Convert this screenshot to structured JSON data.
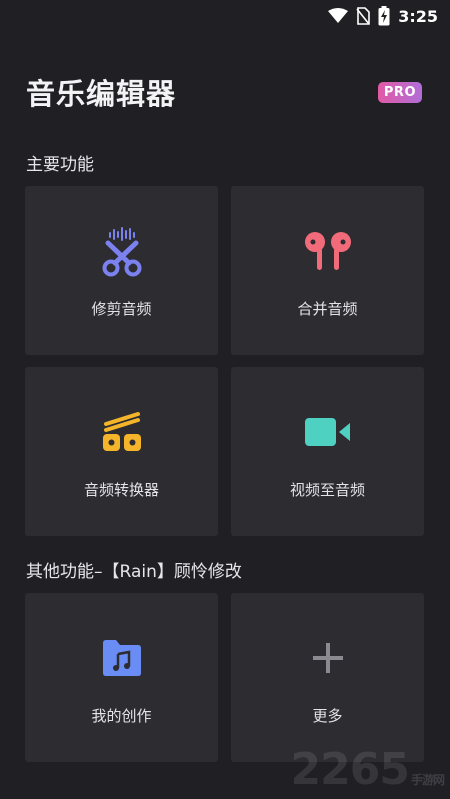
{
  "status_bar": {
    "time": "3:25",
    "icons": [
      "wifi-icon",
      "no-sim-icon",
      "battery-charging-icon"
    ]
  },
  "header": {
    "title": "音乐编辑器",
    "pro_badge": "PRO",
    "pro_colors": [
      "#e25aa6",
      "#b06ed8"
    ]
  },
  "main_section": {
    "title": "主要功能",
    "tiles": [
      {
        "label": "修剪音频",
        "icon": "scissors-waveform-icon",
        "color": "#7b82f0"
      },
      {
        "label": "合并音频",
        "icon": "earbuds-icon",
        "color": "#f26b7b"
      },
      {
        "label": "音频转换器",
        "icon": "converter-rolls-icon",
        "color": "#f5b52a"
      },
      {
        "label": "视频至音频",
        "icon": "video-camera-icon",
        "color": "#4fd1c1"
      }
    ]
  },
  "other_section": {
    "title": "其他功能–【Rain】顾怜修改",
    "tiles": [
      {
        "label": "我的创作",
        "icon": "music-folder-icon",
        "color": "#6a8cf5"
      },
      {
        "label": "更多",
        "icon": "plus-icon",
        "color": "#8a8a90"
      }
    ]
  },
  "watermark": {
    "text": "2265",
    "sub": "手游网"
  }
}
